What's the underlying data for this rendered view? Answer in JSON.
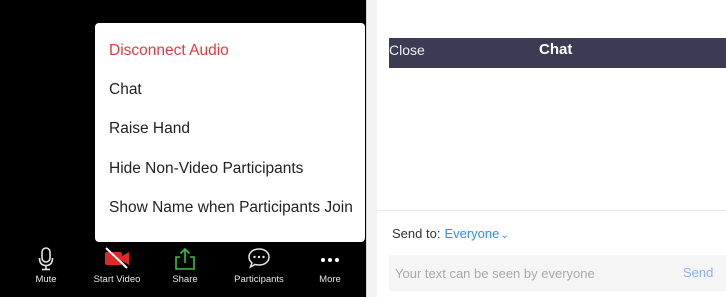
{
  "meeting": {
    "menu": {
      "items": [
        {
          "label": "Disconnect Audio",
          "color": "#e8383a"
        },
        {
          "label": "Chat"
        },
        {
          "label": "Raise Hand"
        },
        {
          "label": "Hide Non-Video Participants"
        },
        {
          "label": "Show Name when Participants Join"
        }
      ]
    },
    "toolbar": {
      "mute": {
        "label": "Mute",
        "icon": "microphone-icon"
      },
      "start_video": {
        "label": "Start Video",
        "icon": "video-off-icon",
        "icon_color": "#e02828"
      },
      "share": {
        "label": "Share",
        "icon": "share-upload-icon",
        "icon_color": "#35c23e"
      },
      "participants": {
        "label": "Participants",
        "icon": "chat-bubble-icon"
      },
      "more": {
        "label": "More",
        "icon": "ellipsis-icon"
      }
    }
  },
  "chat": {
    "header": {
      "close_label": "Close",
      "title": "Chat",
      "background": "#3b3b54"
    },
    "send_to": {
      "label": "Send to:",
      "recipient": "Everyone",
      "accent": "#2d8cff"
    },
    "input": {
      "placeholder": "Your text can be seen by everyone",
      "value": ""
    },
    "send_label": "Send"
  }
}
